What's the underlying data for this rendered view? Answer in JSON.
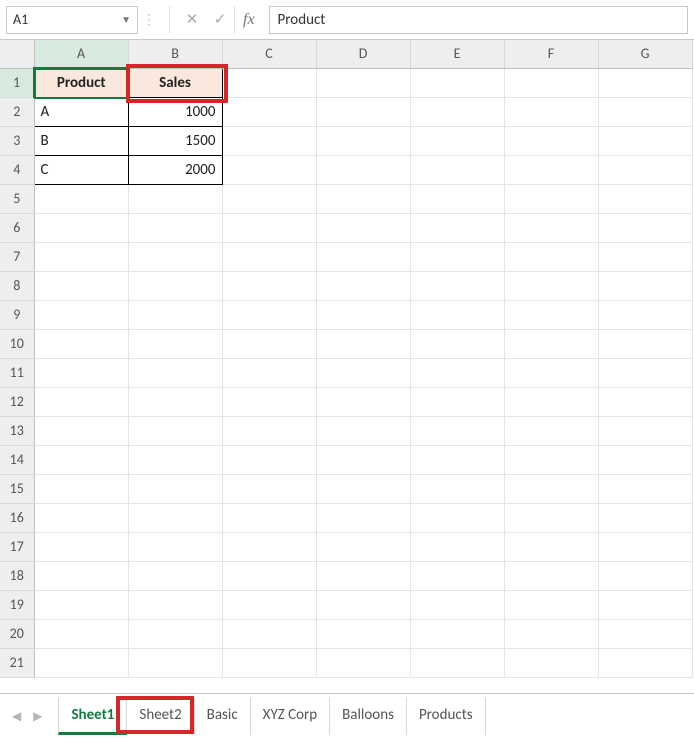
{
  "name_box": "A1",
  "fx_label": "fx",
  "formula_value": "Product",
  "columns": [
    "A",
    "B",
    "C",
    "D",
    "E",
    "F",
    "G"
  ],
  "rows": [
    "1",
    "2",
    "3",
    "4",
    "5",
    "6",
    "7",
    "8",
    "9",
    "10",
    "11",
    "12",
    "13",
    "14",
    "15",
    "16",
    "17",
    "18",
    "19",
    "20",
    "21"
  ],
  "header_row": {
    "A": "Product",
    "B": "Sales"
  },
  "data_rows": [
    {
      "A": "A",
      "B": "1000"
    },
    {
      "A": "B",
      "B": "1500"
    },
    {
      "A": "C",
      "B": "2000"
    }
  ],
  "sheet_tabs": [
    "Sheet1",
    "Sheet2",
    "Basic",
    "XYZ Corp",
    "Balloons",
    "Products"
  ],
  "active_tab": "Sheet1"
}
